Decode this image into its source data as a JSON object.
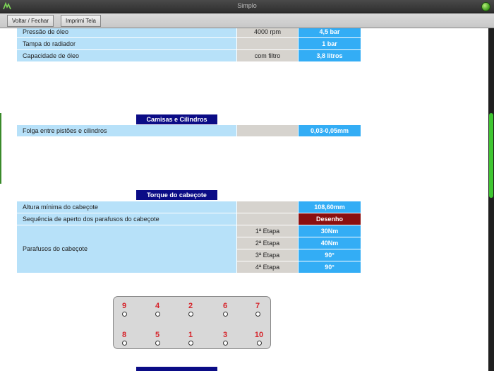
{
  "window": {
    "title": "Simplo"
  },
  "toolbar": {
    "back_close": "Voltar / Fechar",
    "print_screen": "Imprimi Tela"
  },
  "oil": {
    "rows": [
      {
        "label": "Pressão de óleo",
        "cond": "4000 rpm",
        "value": "4,5 bar"
      },
      {
        "label": "Tampa do radiador",
        "cond": "",
        "value": "1 bar"
      },
      {
        "label": "Capacidade de óleo",
        "cond": "com filtro",
        "value": "3,8 litros"
      }
    ]
  },
  "liners": {
    "title": "Camisas e Cilindros",
    "rows": [
      {
        "label": "Folga entre pistões e cilindros",
        "cond": "",
        "value": "0,03-0,05mm"
      }
    ]
  },
  "head_torque": {
    "title": "Torque do cabeçote",
    "min_height": {
      "label": "Altura mínima do cabeçote",
      "cond": "",
      "value": "108,60mm"
    },
    "sequence": {
      "label": "Sequência de aperto dos parafusos do cabeçote",
      "cond": "",
      "value": "Desenho"
    },
    "bolts_label": "Parafusos do cabeçote",
    "stages": [
      {
        "cond": "1ª Etapa",
        "value": "30Nm"
      },
      {
        "cond": "2ª Etapa",
        "value": "40Nm"
      },
      {
        "cond": "3ª Etapa",
        "value": "90°"
      },
      {
        "cond": "4ª Etapa",
        "value": "90°"
      }
    ]
  },
  "bolt_diagram": {
    "top_row": [
      "9",
      "4",
      "2",
      "6",
      "7"
    ],
    "bottom_row": [
      "8",
      "5",
      "1",
      "3",
      "10"
    ]
  },
  "colors": {
    "label_bg": "#b7e1f9",
    "cond_bg": "#d6d3ce",
    "value_bg": "#33adf5",
    "section_title_bg": "#0b0c86",
    "highlight_red": "#8b0f0f",
    "bolt_number": "#d6242b"
  }
}
